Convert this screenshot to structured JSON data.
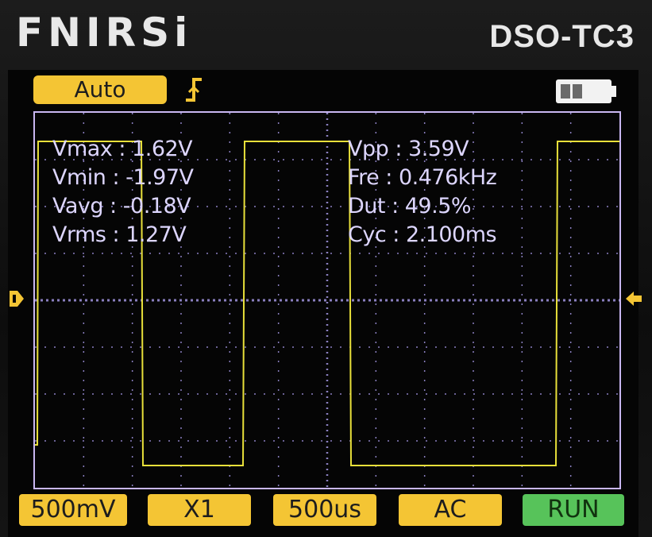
{
  "device": {
    "brand": "FNIRSi",
    "model": "DSO-TC3"
  },
  "top_bar": {
    "mode_label": "Auto",
    "trigger_icon": "rising-edge-trigger-icon",
    "battery_icon": "battery-icon",
    "battery_level": 0.5
  },
  "measurements": {
    "vmax": "Vmax : 1.62V",
    "vmin": "Vmin : -1.97V",
    "vavg": "Vavg : -0.18V",
    "vrms": "Vrms : 1.27V",
    "vpp": "Vpp : 3.59V",
    "fre": "Fre : 0.476kHz",
    "dut": "Dut : 49.5%",
    "cyc": "Cyc : 2.100ms"
  },
  "bottom_bar": {
    "volts_div": "500mV",
    "probe": "X1",
    "time_div": "500us",
    "coupling": "AC",
    "run_state": "RUN"
  },
  "colors": {
    "trace": "#e8e03a",
    "accent": "#f4c534",
    "run": "#57c35a",
    "grid": "#b7a8ff",
    "text": "#ddd6ff"
  }
}
